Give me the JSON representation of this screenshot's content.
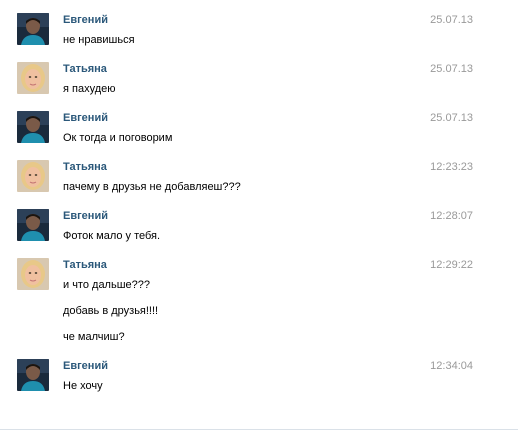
{
  "messages": [
    {
      "author": "Евгений",
      "time": "25.07.13",
      "avatar": "evgeny-avatar",
      "lines": [
        "не нравишься"
      ]
    },
    {
      "author": "Татьяна",
      "time": "25.07.13",
      "avatar": "tatyana-avatar",
      "lines": [
        "я пахудею"
      ]
    },
    {
      "author": "Евгений",
      "time": "25.07.13",
      "avatar": "evgeny-avatar",
      "lines": [
        "Ок тогда и поговорим"
      ]
    },
    {
      "author": "Татьяна",
      "time": "12:23:23",
      "avatar": "tatyana-avatar",
      "lines": [
        "пачему в друзья не добавляеш???"
      ]
    },
    {
      "author": "Евгений",
      "time": "12:28:07",
      "avatar": "evgeny-avatar",
      "lines": [
        "Фоток мало у тебя."
      ]
    },
    {
      "author": "Татьяна",
      "time": "12:29:22",
      "avatar": "tatyana-avatar",
      "lines": [
        "и что дальше???",
        "добавь в друзья!!!!",
        "че малчиш?"
      ]
    },
    {
      "author": "Евгений",
      "time": "12:34:04",
      "avatar": "evgeny-avatar",
      "lines": [
        "Не хочу"
      ]
    }
  ],
  "colors": {
    "author": "#2b587a",
    "time": "#999999",
    "text": "#000000"
  }
}
